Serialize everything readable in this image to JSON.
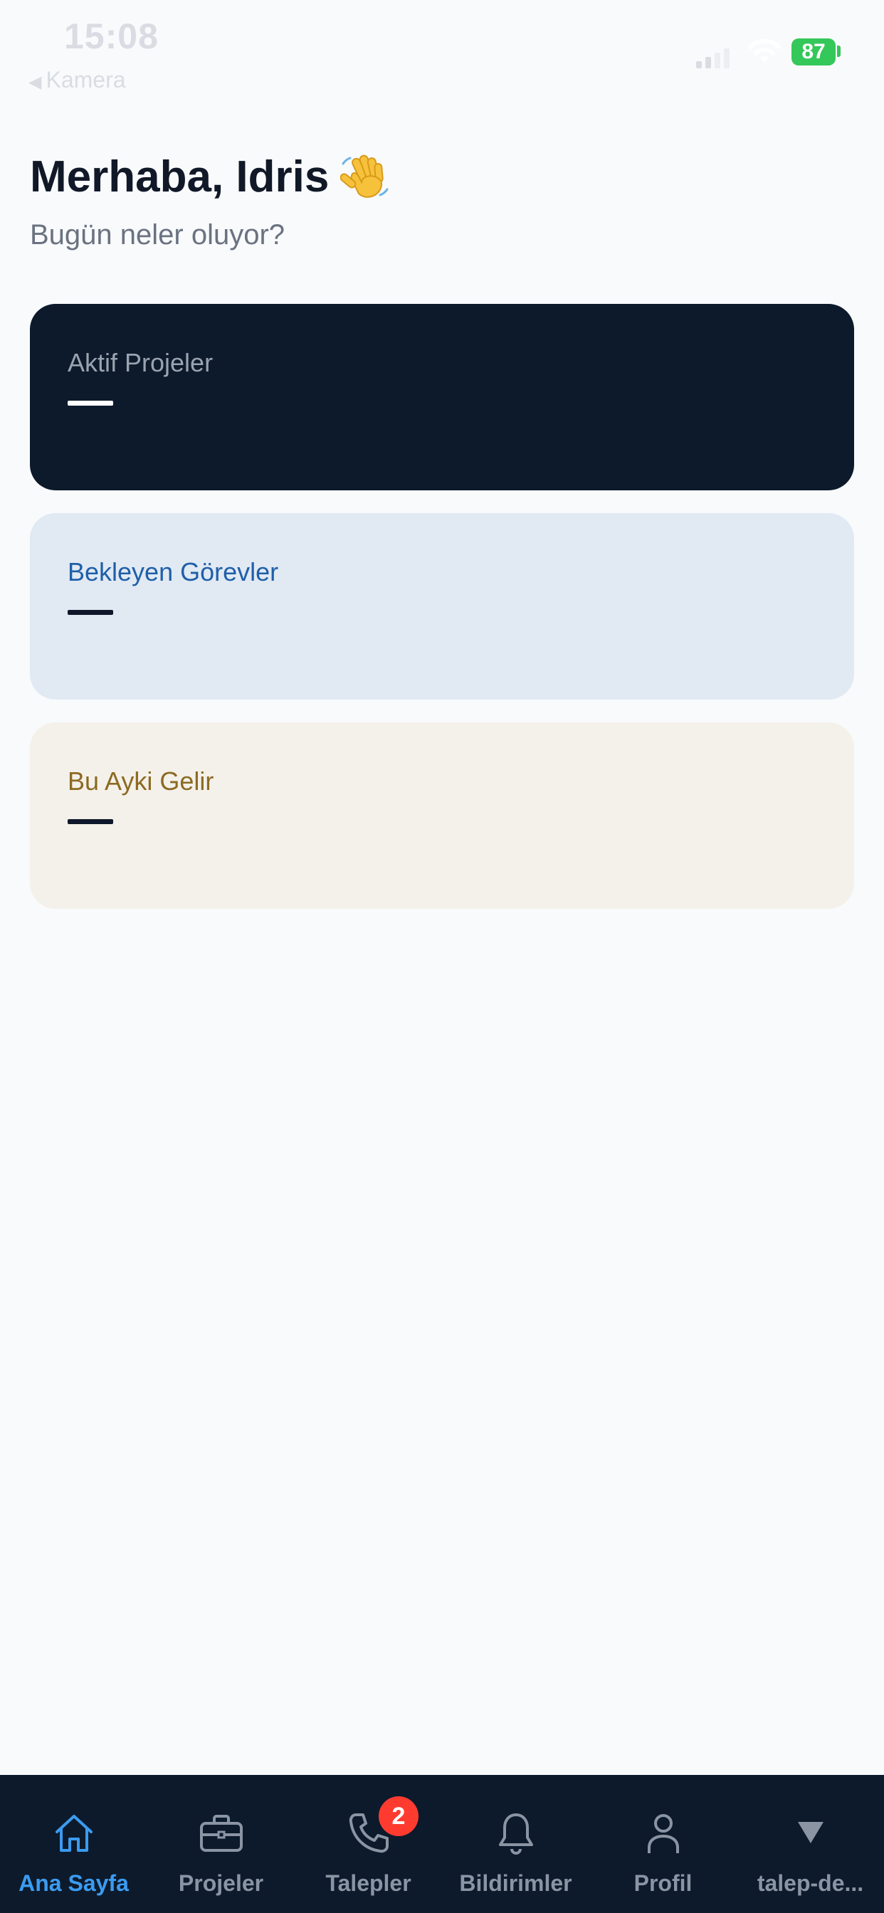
{
  "status_bar": {
    "time": "15:08",
    "back_app": "Kamera",
    "battery": "87"
  },
  "header": {
    "greeting": "Merhaba, Idris",
    "subtitle": "Bugün neler oluyor?"
  },
  "cards": [
    {
      "label": "Aktif Projeler",
      "value": "—"
    },
    {
      "label": "Bekleyen Görevler",
      "value": "—"
    },
    {
      "label": "Bu Ayki Gelir",
      "value": "—"
    }
  ],
  "tab_bar": {
    "items": [
      {
        "label": "Ana Sayfa",
        "icon": "home-icon",
        "active": true
      },
      {
        "label": "Projeler",
        "icon": "briefcase-icon"
      },
      {
        "label": "Talepler",
        "icon": "phone-icon",
        "badge": "2"
      },
      {
        "label": "Bildirimler",
        "icon": "bell-icon"
      },
      {
        "label": "Profil",
        "icon": "person-icon"
      },
      {
        "label": "talep-de...",
        "icon": "triangle-down-icon"
      }
    ]
  },
  "colors": {
    "background": "#f8fafc",
    "dark_card": "#0c1a2b",
    "blue_card": "#e1e9f3",
    "beige_card": "#f4f1ea",
    "accent": "#3b9bf0",
    "badge": "#ff3b30"
  }
}
